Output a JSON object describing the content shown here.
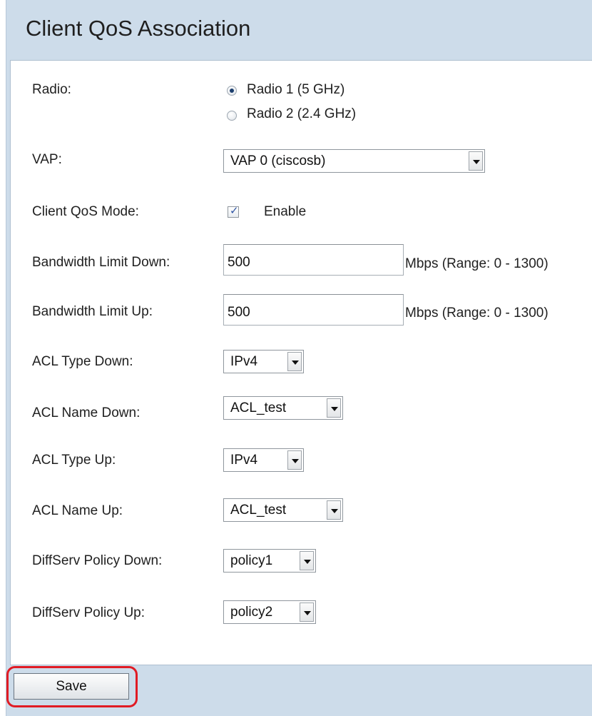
{
  "page": {
    "title": "Client QoS Association"
  },
  "form": {
    "radio": {
      "label": "Radio:",
      "options": [
        "Radio 1 (5 GHz)",
        "Radio 2 (2.4 GHz)"
      ],
      "selected_index": 0
    },
    "vap": {
      "label": "VAP:",
      "value": "VAP 0 (ciscosb)"
    },
    "client_qos_mode": {
      "label": "Client QoS Mode:",
      "checkbox_label": "Enable",
      "checked": true
    },
    "bandwidth_down": {
      "label": "Bandwidth Limit Down:",
      "value": "500",
      "unit": "Mbps (Range: 0 - 1300)"
    },
    "bandwidth_up": {
      "label": "Bandwidth Limit Up:",
      "value": "500",
      "unit": "Mbps (Range: 0 - 1300)"
    },
    "acl_type_down": {
      "label": "ACL Type Down:",
      "value": "IPv4"
    },
    "acl_name_down": {
      "label": "ACL Name Down:",
      "value": "ACL_test"
    },
    "acl_type_up": {
      "label": "ACL Type Up:",
      "value": "IPv4"
    },
    "acl_name_up": {
      "label": "ACL Name Up:",
      "value": "ACL_test"
    },
    "diffserv_down": {
      "label": "DiffServ Policy Down:",
      "value": "policy1"
    },
    "diffserv_up": {
      "label": "DiffServ Policy Up:",
      "value": "policy2"
    }
  },
  "actions": {
    "save_label": "Save"
  },
  "colors": {
    "background": "#cddcea",
    "panel": "#ffffff",
    "highlight": "#e01b24"
  }
}
